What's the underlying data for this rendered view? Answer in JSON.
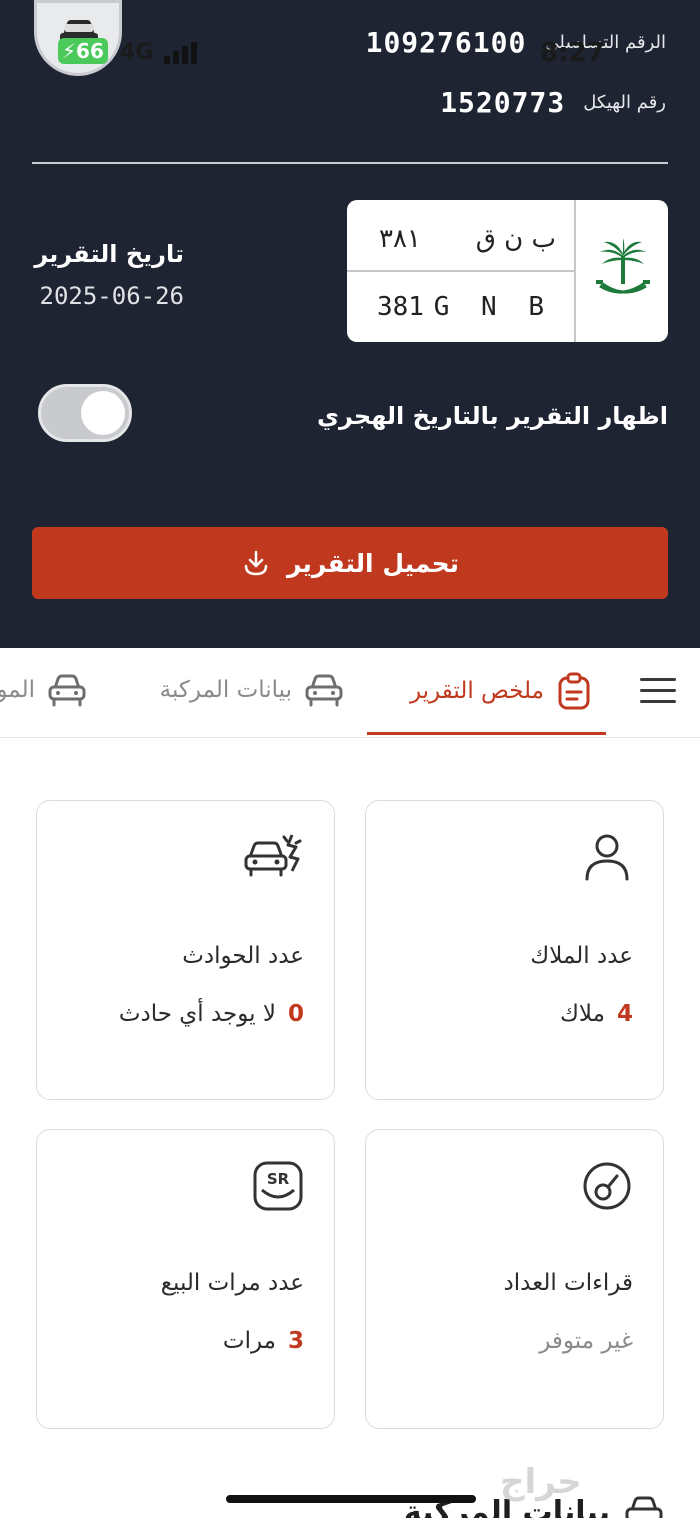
{
  "status_bar": {
    "battery": "66",
    "network": "4G",
    "time": "8:27"
  },
  "vehicle_info": {
    "serial_label": "الرقم التسلسلي",
    "serial_value": "109276100",
    "chassis_label": "رقم الهيكل",
    "chassis_value": "1520773"
  },
  "report_date": {
    "label": "تاريخ التقرير",
    "value": "2025-06-26"
  },
  "plate": {
    "arabic_letters": "ب ن ق",
    "arabic_numbers": "٣٨١",
    "latin_letters": "G N B",
    "latin_numbers": "381",
    "emblem_icon": "saudi-emblem-icon"
  },
  "hijri_toggle": {
    "label": "اظهار التقرير بالتاريخ الهجري",
    "state": "off"
  },
  "download": {
    "label": "تحميل التقرير",
    "icon": "download-icon"
  },
  "tabs": [
    {
      "label": "ملخص التقرير",
      "icon": "clipboard-icon",
      "active": true
    },
    {
      "label": "بيانات المركبة",
      "icon": "car-icon",
      "active": false
    },
    {
      "label": "الموا",
      "icon": "car-icon",
      "active": false
    }
  ],
  "cards": {
    "owners": {
      "title": "عدد الملاك",
      "number": "4",
      "unit": "ملاك",
      "icon": "person-icon"
    },
    "accidents": {
      "title": "عدد الحوادث",
      "number": "0",
      "unit": "لا يوجد أي حادث",
      "icon": "car-crash-icon"
    },
    "odometer": {
      "title": "قراءات العداد",
      "value": "غير متوفر",
      "icon": "gauge-icon"
    },
    "sales": {
      "title": "عدد مرات البيع",
      "number": "3",
      "unit": "مرات",
      "icon": "sr-badge-icon"
    }
  },
  "next_section": {
    "label": "بيانات المركبة"
  },
  "watermark": "حراج",
  "colors": {
    "header_bg": "#1f2432",
    "accent": "#c0391f",
    "emblem_green": "#1c7a3a"
  }
}
